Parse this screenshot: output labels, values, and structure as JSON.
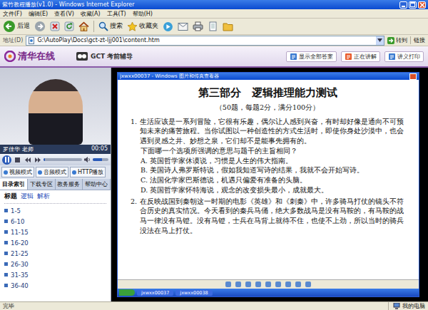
{
  "window": {
    "title": "紫竹教程播放(v1.0) - Windows Internet Explorer"
  },
  "menu": [
    "文件(F)",
    "编辑(E)",
    "查看(V)",
    "收藏(A)",
    "工具(T)",
    "帮助(H)"
  ],
  "toolbar": {
    "back": "后退",
    "search": "搜索",
    "favorites": "收藏夹"
  },
  "address": {
    "label": "地址(D)",
    "url": "G:\\AutoPlay\\Docs\\gct-zt-ljj001\\content.htm",
    "go": "转到",
    "links": "链接"
  },
  "header": {
    "logo": "清华在线",
    "course": "GCT 考前辅导",
    "buttons": [
      "显示全部答案",
      "正在讲解",
      "讲义打印"
    ]
  },
  "player": {
    "teacher": "罗佳华 老师",
    "time": "00:05",
    "progress": 0.04,
    "volume": 0.6,
    "modes": [
      "视频模式",
      "音频模式",
      "HTTP播放"
    ]
  },
  "sidebar": {
    "tabs": [
      {
        "label": "目录索引",
        "selected": true
      },
      {
        "label": "下载专区",
        "selected": false
      },
      {
        "label": "教务服务",
        "selected": false
      },
      {
        "label": "帮助中心",
        "selected": false
      }
    ],
    "heading": {
      "label": "标题",
      "links": [
        "逻辑",
        "解析"
      ]
    },
    "items": [
      "1-5",
      "6-10",
      "11-15",
      "16-20",
      "21-25",
      "26-30",
      "31-35",
      "36-40"
    ]
  },
  "viewer": {
    "title": "jxwxx00037 - Windows 图片和传真查看器",
    "heading": "第三部分　逻辑推理能力测试",
    "subheading": "（50题，每题2分，满分100分）",
    "questions": [
      {
        "number": "1.",
        "text": "生活应该是一系列冒险，它很有乐趣，偶尔让人感到兴奋，有时却好像是通向不可预知未来的痛苦旅程。当你试图以一种创造性的方式生活时，即使你身处沙漠中，也会遇到灵感之井、妙想之泉，它们却不是能事先拥有的。",
        "prompt": "下面哪一个选项所强调的意思与题干的主旨相同？",
        "options": [
          "A. 英国哲学家休谟说，习惯是人生的伟大指南。",
          "B. 美国诗人弗罗斯特说，假如我知道写诗的结果，我就不会开始写诗。",
          "C. 法国化学家巴斯德说，机遇只偏爱有准备的头脑。",
          "D. 英国哲学家怀特海说，观念的改变损失最小，成就最大。"
        ]
      },
      {
        "number": "2.",
        "text": "在反映战国到秦朝这一时期的电影《英雄》和《刺秦》中，许多骑马打仗的镜头不符合历史的真实情况。今天看到的秦兵马俑，绝大多数战马是没有马鞍的，有马鞍的战马一律没有马镫。没有马镫，士兵在马背上就待不住，也使不上劲，所以当时的骑兵没法在马上打仗。",
        "prompt": "",
        "options": []
      }
    ],
    "taskbar": [
      "jxwxx00037",
      "jxwxx00038"
    ]
  },
  "status_bar": {
    "left": "完毕",
    "right": "我的电脑"
  }
}
